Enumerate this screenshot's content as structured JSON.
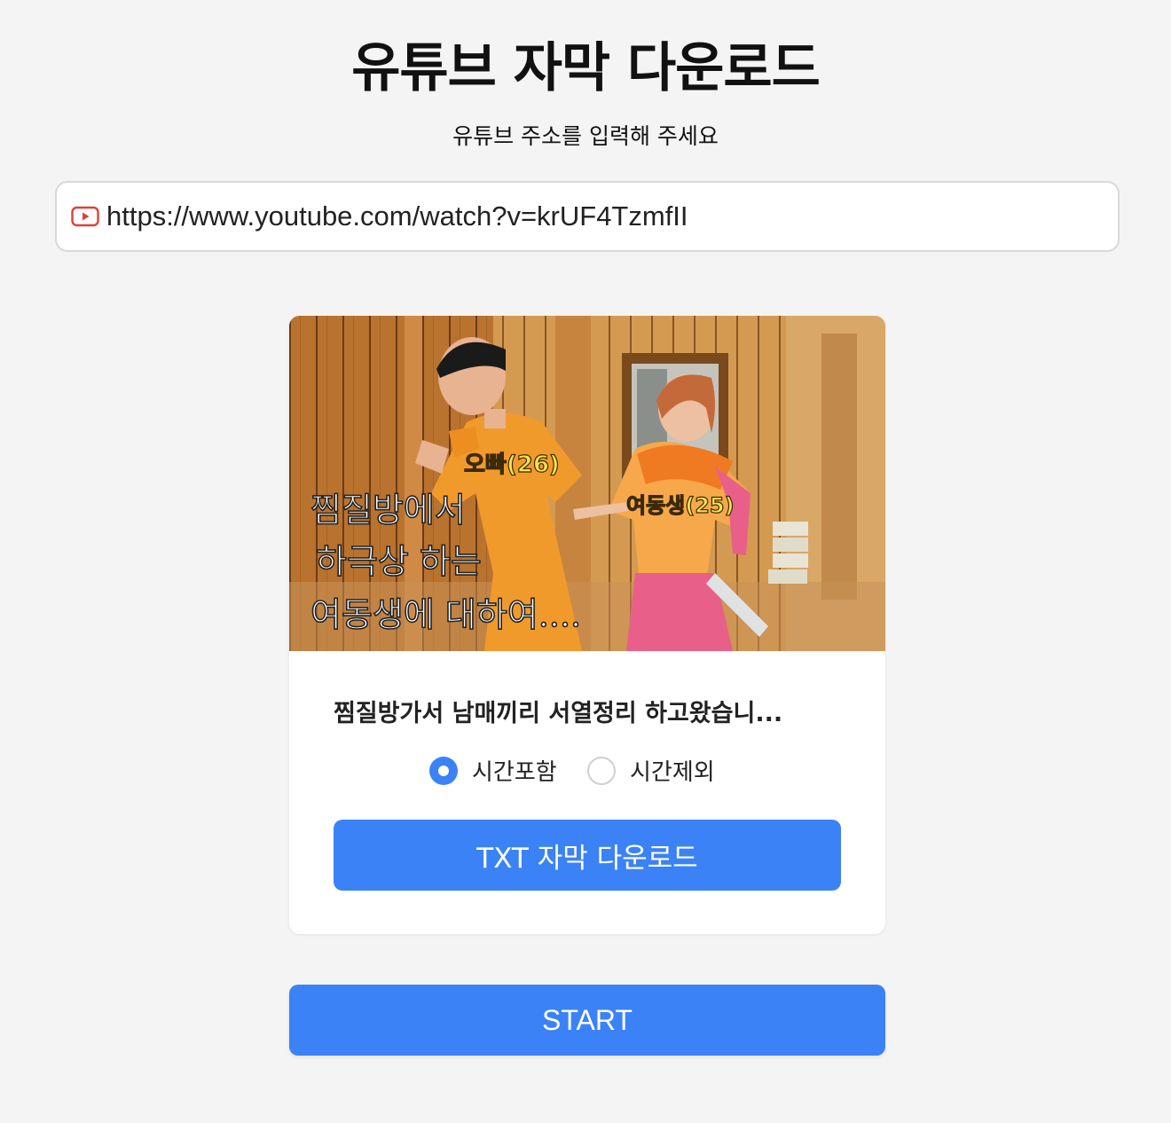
{
  "header": {
    "title": "유튜브 자막 다운로드",
    "subtitle": "유튜브 주소를 입력해 주세요"
  },
  "url_input": {
    "value": "https://www.youtube.com/watch?v=krUF4TzmfII",
    "icon": "youtube-icon"
  },
  "video": {
    "thumbnail_text": {
      "label_brother": "오빠(26)",
      "label_sister": "여동생(25)",
      "caption_lines": [
        "찜질방에서",
        "하극상 하는",
        "여동생에 대하여...."
      ]
    },
    "title": "찜질방가서 남매끼리 서열정리 하고왔습니..."
  },
  "options": {
    "include_time": "시간포함",
    "exclude_time": "시간제외",
    "selected": "include_time"
  },
  "buttons": {
    "download_txt": "TXT 자막 다운로드",
    "start": "START"
  },
  "colors": {
    "accent": "#3b82f6",
    "youtube_red": "#e0403a",
    "background": "#f4f4f4"
  }
}
